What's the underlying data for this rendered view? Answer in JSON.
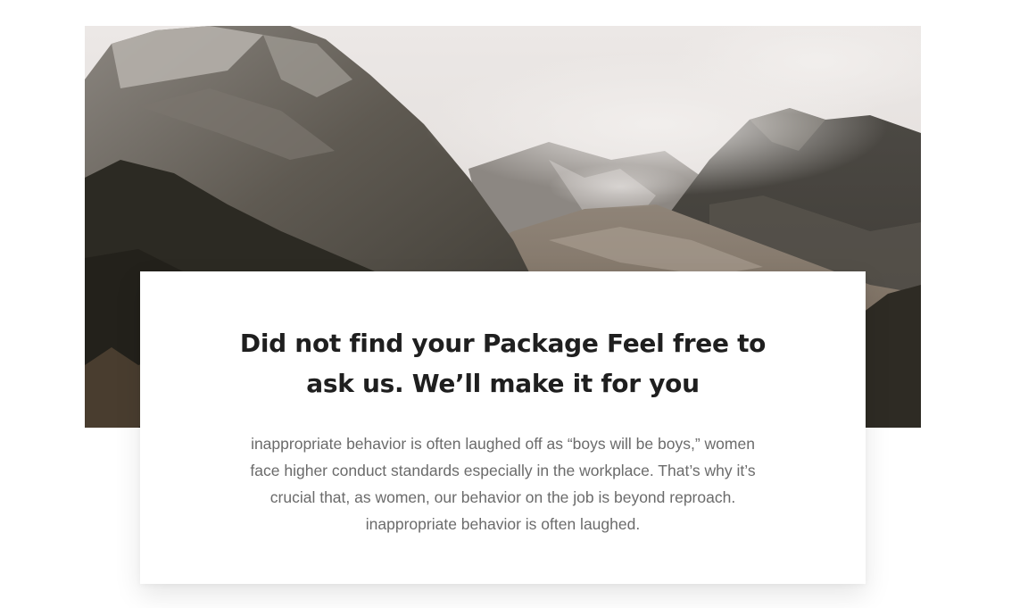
{
  "hero": {
    "image_name": "mountain-landscape-image"
  },
  "cta_card": {
    "heading": "Did not find your Package Feel free to ask us. We’ll make it for you",
    "description": "inappropriate behavior is often laughed off as “boys will be boys,” women face higher conduct standards especially in the workplace. That’s why it’s crucial that, as women, our behavior on the job is beyond reproach. inappropriate behavior is often laughed."
  }
}
